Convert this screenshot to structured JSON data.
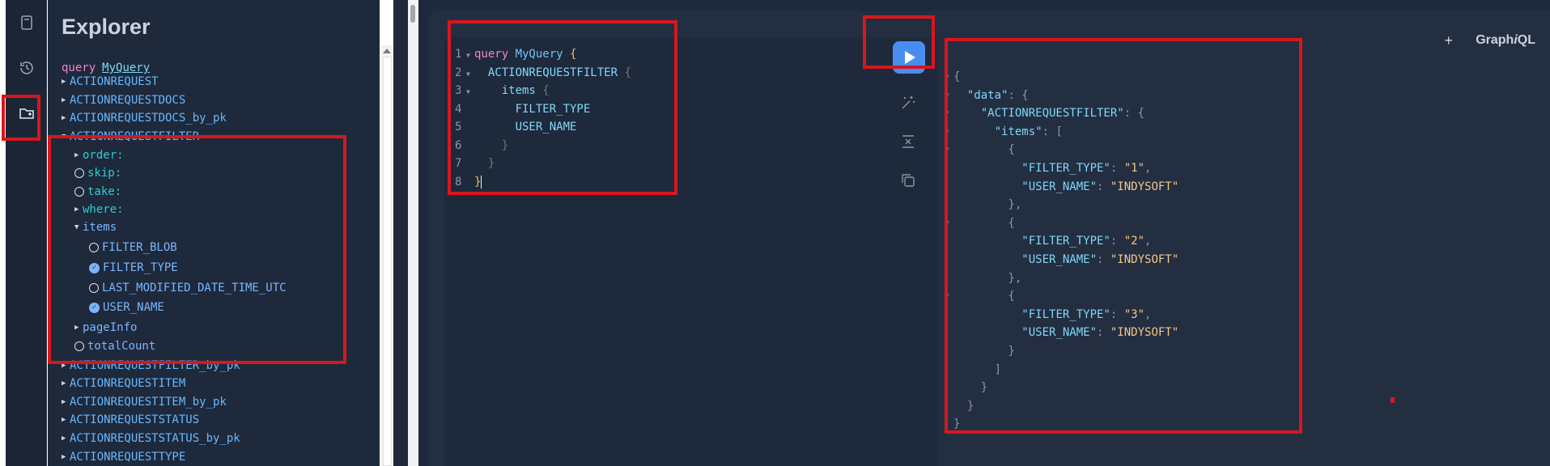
{
  "sidebar_icons": [
    {
      "name": "docs-icon"
    },
    {
      "name": "history-icon"
    },
    {
      "name": "explorer-folder-icon"
    }
  ],
  "explorer": {
    "title": "Explorer",
    "operation_keyword": "query",
    "operation_name": "MyQuery",
    "items": [
      {
        "label": "ACTIONREQUEST",
        "type": "field",
        "marker": "caret-right"
      },
      {
        "label": "ACTIONREQUESTDOCS",
        "type": "field",
        "marker": "caret-right"
      },
      {
        "label": "ACTIONREQUESTDOCS_by_pk",
        "type": "field",
        "marker": "caret-right"
      },
      {
        "label": "ACTIONREQUESTFILTER",
        "type": "field",
        "marker": "caret-down"
      },
      {
        "label": "order:",
        "type": "arg",
        "marker": "caret-right"
      },
      {
        "label": "skip:",
        "type": "arg",
        "marker": "circle"
      },
      {
        "label": "take:",
        "type": "arg",
        "marker": "circle"
      },
      {
        "label": "where:",
        "type": "arg",
        "marker": "caret-right"
      },
      {
        "label": "items",
        "type": "sub",
        "marker": "caret-down"
      },
      {
        "label": "FILTER_BLOB",
        "type": "sub",
        "marker": "circle"
      },
      {
        "label": "FILTER_TYPE",
        "type": "sub",
        "marker": "checked"
      },
      {
        "label": "LAST_MODIFIED_DATE_TIME_UTC",
        "type": "sub",
        "marker": "circle"
      },
      {
        "label": "USER_NAME",
        "type": "sub",
        "marker": "checked"
      },
      {
        "label": "pageInfo",
        "type": "sub",
        "marker": "caret-right"
      },
      {
        "label": "totalCount",
        "type": "sub",
        "marker": "circle"
      },
      {
        "label": "ACTIONREQUESTFILTER_by_pk",
        "type": "field",
        "marker": "caret-right"
      },
      {
        "label": "ACTIONREQUESTITEM",
        "type": "field",
        "marker": "caret-right"
      },
      {
        "label": "ACTIONREQUESTITEM_by_pk",
        "type": "field",
        "marker": "caret-right"
      },
      {
        "label": "ACTIONREQUESTSTATUS",
        "type": "field",
        "marker": "caret-right"
      },
      {
        "label": "ACTIONREQUESTSTATUS_by_pk",
        "type": "field",
        "marker": "caret-right"
      },
      {
        "label": "ACTIONREQUESTTYPE",
        "type": "field",
        "marker": "caret-right"
      }
    ]
  },
  "editor": {
    "lines": [
      {
        "n": "1",
        "tokens": [
          {
            "t": "query ",
            "c": "c-kw"
          },
          {
            "t": "MyQuery",
            "c": "c-name"
          },
          {
            "t": " {",
            "c": "c-brace"
          }
        ]
      },
      {
        "n": "2",
        "tokens": [
          {
            "t": "  ACTIONREQUESTFILTER",
            "c": "c-field"
          },
          {
            "t": " {",
            "c": "c-dim"
          }
        ]
      },
      {
        "n": "3",
        "tokens": [
          {
            "t": "    items",
            "c": "c-field"
          },
          {
            "t": " {",
            "c": "c-dim"
          }
        ]
      },
      {
        "n": "4",
        "tokens": [
          {
            "t": "      FILTER_TYPE",
            "c": "c-field"
          }
        ]
      },
      {
        "n": "5",
        "tokens": [
          {
            "t": "      USER_NAME",
            "c": "c-field"
          }
        ]
      },
      {
        "n": "6",
        "tokens": [
          {
            "t": "    }",
            "c": "c-dim"
          }
        ]
      },
      {
        "n": "7",
        "tokens": [
          {
            "t": "  }",
            "c": "c-dim"
          }
        ]
      },
      {
        "n": "8",
        "tokens": [
          {
            "t": "}",
            "c": "c-brace"
          }
        ]
      }
    ]
  },
  "toolbar": {
    "run_icon": "play-icon",
    "tools": [
      "prettify-icon",
      "merge-fragments-icon",
      "copy-icon"
    ]
  },
  "header": {
    "add_tab": "+",
    "logo_prefix": "Graph",
    "logo_i": "i",
    "logo_suffix": "QL"
  },
  "result": {
    "lines": [
      "{",
      "  \"data\": {",
      "    \"ACTIONREQUESTFILTER\": {",
      "      \"items\": [",
      "        {",
      "          \"FILTER_TYPE\": \"1\",",
      "          \"USER_NAME\": \"INDYSOFT\"",
      "        },",
      "        {",
      "          \"FILTER_TYPE\": \"2\",",
      "          \"USER_NAME\": \"INDYSOFT\"",
      "        },",
      "        {",
      "          \"FILTER_TYPE\": \"3\",",
      "          \"USER_NAME\": \"INDYSOFT\"",
      "        }",
      "      ]",
      "    }",
      "  }",
      "}"
    ]
  },
  "colors": {
    "annotation_red": "#d6171c",
    "run_button": "#4a8df0",
    "panel_bg": "#1e293b"
  }
}
